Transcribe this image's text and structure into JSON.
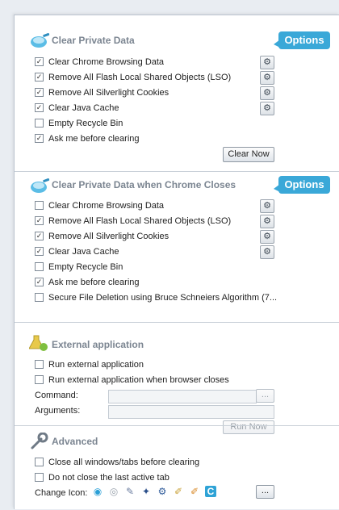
{
  "sections": {
    "clear_private_data": {
      "title": "Clear Private Data",
      "options_label": "Options",
      "items": [
        {
          "label": "Clear Chrome Browsing Data",
          "checked": true
        },
        {
          "label": "Remove All Flash Local Shared Objects (LSO)",
          "checked": true
        },
        {
          "label": "Remove All Silverlight Cookies",
          "checked": true
        },
        {
          "label": "Clear Java Cache",
          "checked": true
        },
        {
          "label": "Empty Recycle Bin",
          "checked": false
        },
        {
          "label": "Ask me before clearing",
          "checked": true
        }
      ],
      "clear_now_label": "Clear Now"
    },
    "on_close": {
      "title": "Clear Private Data when Chrome Closes",
      "options_label": "Options",
      "items": [
        {
          "label": "Clear Chrome Browsing Data",
          "checked": false
        },
        {
          "label": "Remove All Flash Local Shared Objects (LSO)",
          "checked": true
        },
        {
          "label": "Remove All Silverlight Cookies",
          "checked": true
        },
        {
          "label": "Clear Java Cache",
          "checked": true
        },
        {
          "label": "Empty Recycle Bin",
          "checked": false
        },
        {
          "label": "Ask me before clearing",
          "checked": true
        },
        {
          "label": "Secure File Deletion using Bruce Schneiers Algorithm (7...",
          "checked": false
        }
      ]
    },
    "external_app": {
      "title": "External application",
      "items": [
        {
          "label": "Run external application",
          "checked": false
        },
        {
          "label": "Run external application when browser closes",
          "checked": false
        }
      ],
      "command_label": "Command:",
      "arguments_label": "Arguments:",
      "command_value": "",
      "arguments_value": "",
      "browse_label": "...",
      "run_now_label": "Run Now"
    },
    "advanced": {
      "title": "Advanced",
      "items": [
        {
          "label": "Close all windows/tabs before clearing",
          "checked": false
        },
        {
          "label": "Do not close the last active tab",
          "checked": false
        }
      ],
      "change_icon_label": "Change Icon:",
      "more_label": "...",
      "icons": [
        "broom-icon-blue",
        "broom-icon-grey",
        "eraser-icon",
        "broom-icon-navy",
        "gear-icon",
        "broom-icon-yellow",
        "broom-icon-orange",
        "chrome-c-icon"
      ]
    }
  },
  "colors": {
    "accent": "#3aa8d8",
    "title_grey": "#7b8591"
  }
}
